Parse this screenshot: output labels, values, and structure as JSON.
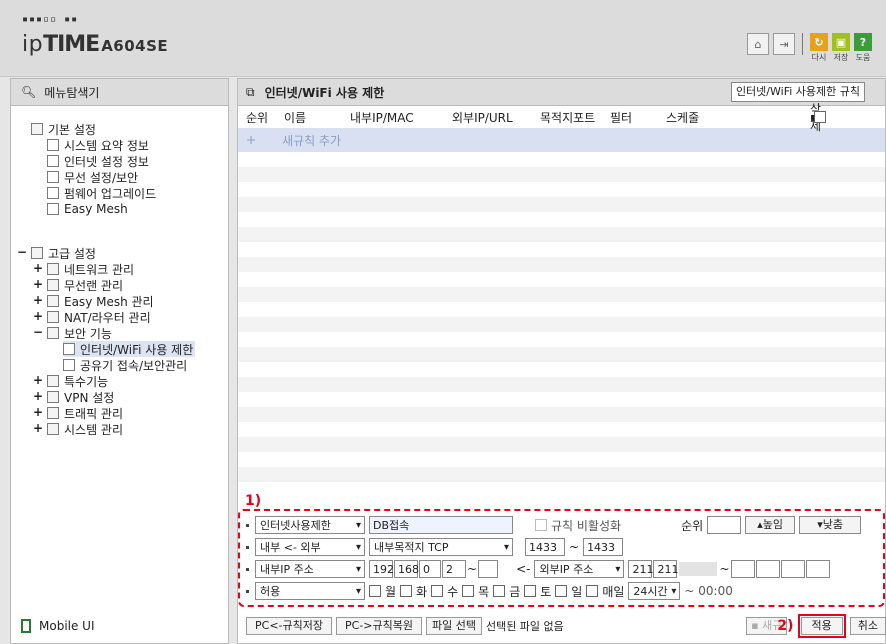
{
  "header": {
    "brand_prefix": "ip",
    "brand_bold": "TIME",
    "model": "A604SE",
    "buttons": [
      {
        "label": "다시",
        "icon": "restart-icon"
      },
      {
        "label": "저장",
        "icon": "save-icon"
      },
      {
        "label": "도움",
        "icon": "help-icon"
      }
    ]
  },
  "sidebar": {
    "title": "메뉴탐색기",
    "basic": {
      "label": "기본 설정",
      "items": [
        "시스템 요약 정보",
        "인터넷 설정 정보",
        "무선 설정/보안",
        "펌웨어 업그레이드",
        "Easy Mesh"
      ]
    },
    "advanced": {
      "label": "고급 설정",
      "items": [
        "네트워크 관리",
        "무선랜 관리",
        "Easy Mesh 관리",
        "NAT/라우터 관리",
        "보안 기능"
      ],
      "security_children": [
        "인터넷/WiFi 사용 제한",
        "공유기 접속/보안관리"
      ],
      "items_after": [
        "특수기능",
        "VPN 설정",
        "트래픽 관리",
        "시스템 관리"
      ]
    },
    "mobile": "Mobile UI"
  },
  "main": {
    "title": "인터넷/WiFi 사용 제한",
    "rule_select": "인터넷/WiFi 사용제한 규칙",
    "columns": [
      "순위",
      "이름",
      "내부IP/MAC",
      "외부IP/URL",
      "목적지포트",
      "필터",
      "스케줄",
      "삭제"
    ],
    "new_rule": "새규칙 추가"
  },
  "editor": {
    "marker": "1)",
    "type": "인터넷사용제한",
    "name": "DB접속",
    "disable_label": "규칙 비활성화",
    "rank_label": "순위",
    "rank_value": "",
    "up_label": "높임",
    "down_label": "낮춤",
    "direction": "내부 <- 외부",
    "port_type": "내부목적지 TCP",
    "port_from": "1433",
    "port_to": "1433",
    "internal_ip_type": "내부IP 주소",
    "internal_ip": [
      "192",
      "168",
      "0",
      "2"
    ],
    "arrow": "<-",
    "external_ip_type": "외부IP 주소",
    "external_ip": [
      "211",
      "211"
    ],
    "action": "허용",
    "days": [
      "월",
      "화",
      "수",
      "목",
      "금",
      "토",
      "일",
      "매일"
    ],
    "time_select": "24시간",
    "time_end": "~ 00:00"
  },
  "bottom": {
    "backup": "PC<-규칙저장",
    "restore": "PC->규칙복원",
    "file_select": "파일 선택",
    "no_file": "선택된 파일 없음",
    "new_btn": "새규",
    "marker": "2)",
    "apply": "적용",
    "cancel": "취소"
  }
}
